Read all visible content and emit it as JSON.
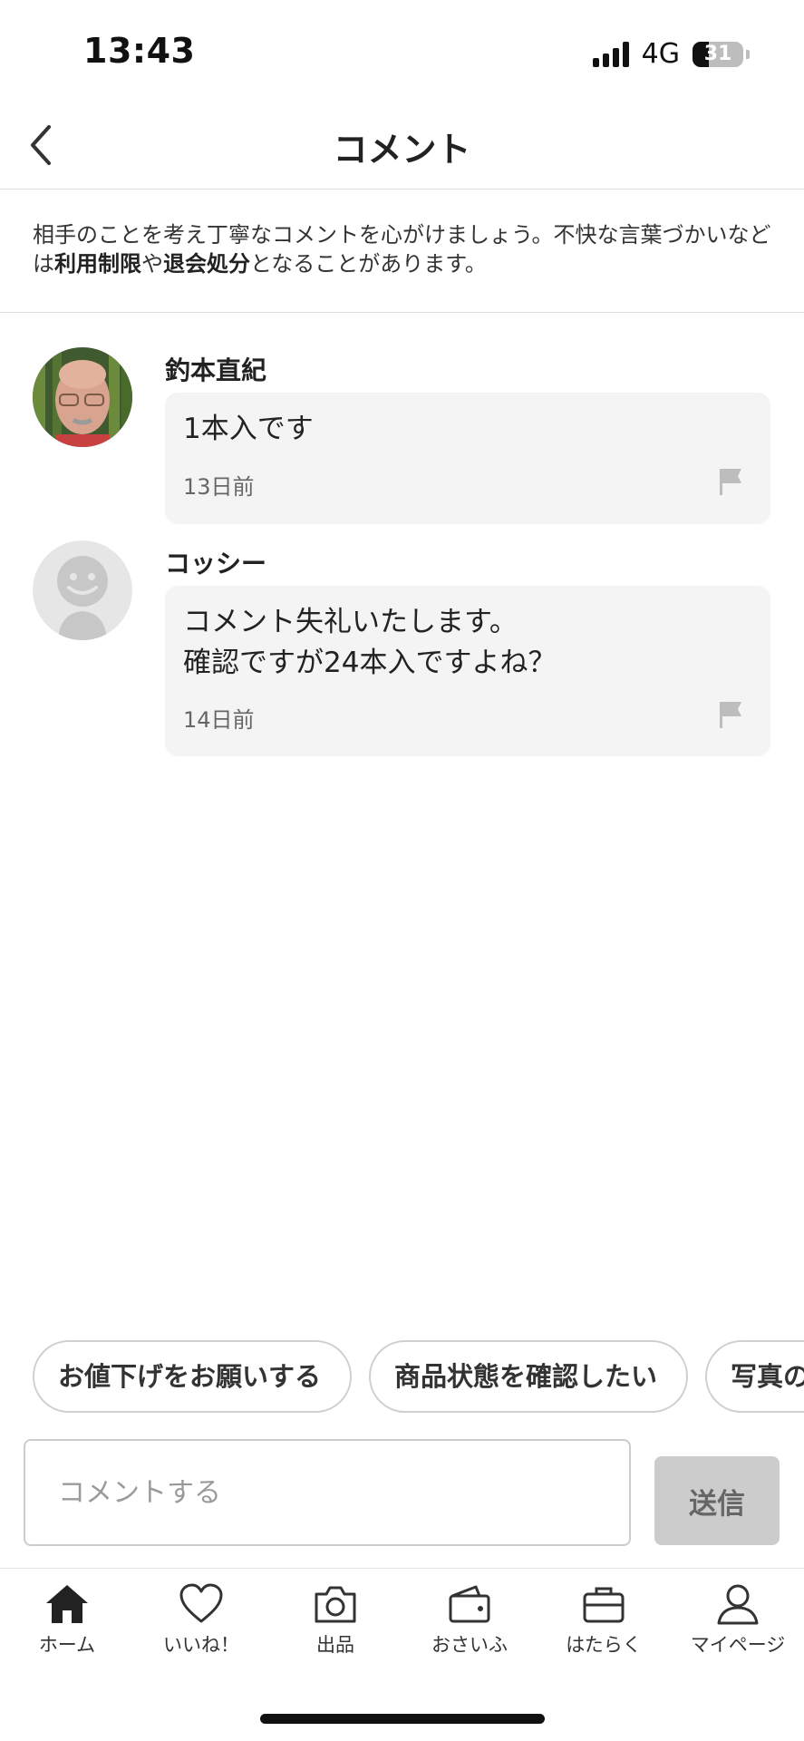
{
  "status_bar": {
    "time": "13:43",
    "network": "4G",
    "battery": "31"
  },
  "header": {
    "title": "コメント"
  },
  "notice": {
    "text_1": "相手のことを考え丁寧なコメントを心がけましょう。不快な言葉づかいなどは",
    "bold_1": "利用制限",
    "text_2": "や",
    "bold_2": "退会処分",
    "text_3": "となることがあります。"
  },
  "comments": [
    {
      "name": "釣本直紀",
      "text": "1本入です",
      "time": "13日前"
    },
    {
      "name": "コッシー",
      "text": "コメント失礼いたします。\n確認ですが24本入ですよね？",
      "time": "14日前"
    }
  ],
  "quick_replies": [
    "お値下げをお願いする",
    "商品状態を確認したい",
    "写真の"
  ],
  "input": {
    "placeholder": "コメントする",
    "send_label": "送信"
  },
  "nav": [
    {
      "label": "ホーム",
      "icon": "home-icon"
    },
    {
      "label": "いいね！",
      "icon": "heart-icon"
    },
    {
      "label": "出品",
      "icon": "camera-icon"
    },
    {
      "label": "おさいふ",
      "icon": "wallet-icon"
    },
    {
      "label": "はたらく",
      "icon": "briefcase-icon"
    },
    {
      "label": "マイページ",
      "icon": "person-icon"
    }
  ]
}
